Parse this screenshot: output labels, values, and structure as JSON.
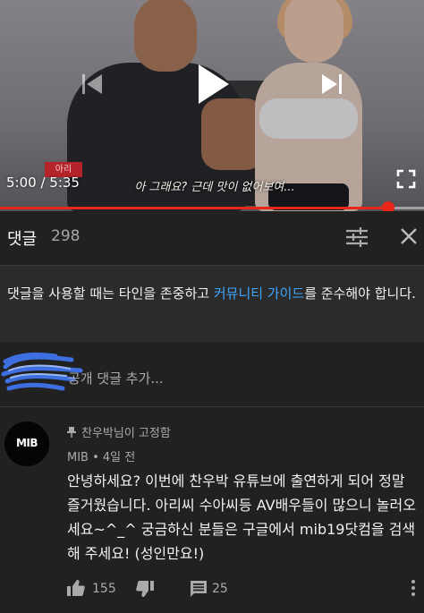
{
  "player": {
    "current_time": "5:00",
    "duration": "5:35",
    "time_display": "5:00 / 5:35",
    "progress_fraction": 0.915,
    "subtitle_speaker": "아리",
    "subtitle_line": "아 그래요? 근데 맛이 없어보여...",
    "accent_color": "#e8261a"
  },
  "comments_header": {
    "title": "댓글",
    "count": "298"
  },
  "notice": {
    "text_before": "댓글을 사용할 때는 타인을 존중하고 ",
    "link_text": "커뮤니티 가이드",
    "text_after": "를 준수해야 합니다.",
    "link_color": "#3ea6ff"
  },
  "add_comment": {
    "placeholder": "공개 댓글 추가..."
  },
  "comment": {
    "avatar_text": "MIB",
    "pinned_label": "찬우박님이 고정함",
    "author": "MIB",
    "time": "4일 전",
    "meta": "MIB • 4일 전",
    "body": "안녕하세요? 이번에 찬우박 유튜브에 출연하게 되어 정말 즐거웠습니다. 아리씨 수아씨등 AV배우들이 많으니 놀러오세요~^_^ 궁금하신 분들은 구글에서 mib19닷컴을 검색해 주세요! (성인만요!)",
    "likes": "155",
    "replies": "25"
  },
  "icons": {
    "prev": "skip-previous-icon",
    "play": "play-icon",
    "next": "skip-next-icon",
    "fullscreen": "fullscreen-icon",
    "sort": "sort-icon",
    "close": "close-icon",
    "pin": "pin-icon",
    "like": "thumbs-up-icon",
    "dislike": "thumbs-down-icon",
    "reply": "reply-icon",
    "menu": "more-vert-icon"
  }
}
